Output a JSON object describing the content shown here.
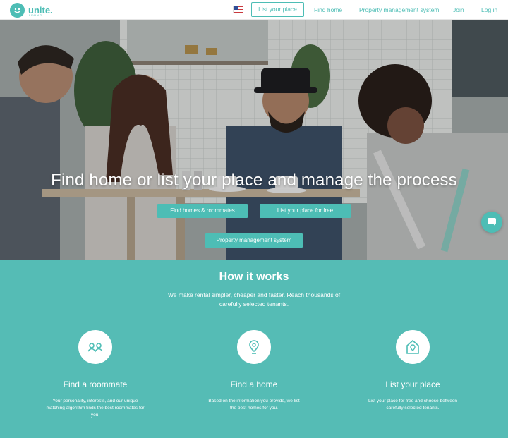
{
  "brand": {
    "name": "unite.",
    "sub": "LIVING",
    "color": "#4dbdb5"
  },
  "nav": {
    "flag_icon": "us-flag-icon",
    "list_place_button": "List your place",
    "links": [
      {
        "id": "find-home",
        "label": "Find home"
      },
      {
        "id": "property-management",
        "label": "Property management system"
      },
      {
        "id": "join",
        "label": "Join"
      },
      {
        "id": "login",
        "label": "Log in"
      }
    ]
  },
  "hero": {
    "title": "Find home or list your place and manage the process",
    "buttons": {
      "find_homes": "Find homes & roommates",
      "list_free": "List your place for free",
      "property_management": "Property management system"
    }
  },
  "chat": {
    "icon": "chat-bubble-icon"
  },
  "how_it_works": {
    "title": "How it works",
    "subtitle": "We make rental simpler, cheaper and faster. Reach thousands of carefully selected tenants.",
    "features": [
      {
        "icon": "roommates-icon",
        "title": "Find a roommate",
        "description": "Your personality, interests, and our unique matching algorithm finds the best roommates for you."
      },
      {
        "icon": "location-pin-icon",
        "title": "Find a home",
        "description": "Based on the information you provide, we list the best homes for you."
      },
      {
        "icon": "house-pin-icon",
        "title": "List your place",
        "description": "List your place for free and choose between carefully selected tenants."
      }
    ]
  }
}
